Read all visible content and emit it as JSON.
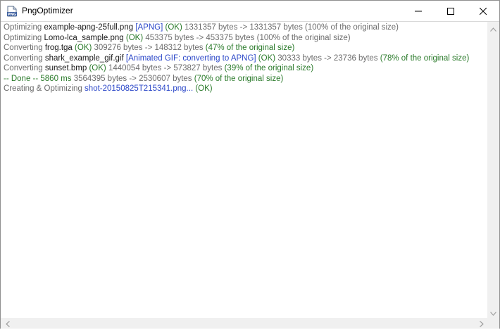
{
  "window": {
    "title": "PngOptimizer",
    "app_icon": "png-file-icon",
    "controls": {
      "minimize_icon": "minimize-icon",
      "maximize_icon": "maximize-icon",
      "close_icon": "close-icon"
    }
  },
  "log": {
    "lines": [
      [
        {
          "text": "Optimizing ",
          "cls": "c-verb"
        },
        {
          "text": "example-apng-25full.png",
          "cls": "c-file"
        },
        {
          "text": " [APNG]",
          "cls": "c-tag"
        },
        {
          "text": "  (OK)",
          "cls": "c-ok"
        },
        {
          "text": " 1331357 bytes -> 1331357 bytes (100% of the original size)",
          "cls": "c-bytes"
        }
      ],
      [
        {
          "text": "Optimizing ",
          "cls": "c-verb"
        },
        {
          "text": "Lomo-lca_sample.png",
          "cls": "c-file"
        },
        {
          "text": "  (OK)",
          "cls": "c-ok"
        },
        {
          "text": " 453375 bytes -> 453375 bytes (100% of the original size)",
          "cls": "c-bytes"
        }
      ],
      [
        {
          "text": "Converting ",
          "cls": "c-verb"
        },
        {
          "text": "frog.tga",
          "cls": "c-file"
        },
        {
          "text": "  (OK)",
          "cls": "c-ok"
        },
        {
          "text": " 309276 bytes -> 148312 bytes ",
          "cls": "c-bytes"
        },
        {
          "text": "(47% of the original size)",
          "cls": "c-pct-green"
        }
      ],
      [
        {
          "text": "Converting ",
          "cls": "c-verb"
        },
        {
          "text": "shark_example_gif.gif",
          "cls": "c-file"
        },
        {
          "text": " [Animated GIF: converting to APNG]",
          "cls": "c-tag"
        },
        {
          "text": "  (OK)",
          "cls": "c-ok"
        },
        {
          "text": " 30333 bytes -> 23736 bytes ",
          "cls": "c-bytes"
        },
        {
          "text": "(78% of the original size)",
          "cls": "c-pct-green"
        }
      ],
      [
        {
          "text": "Converting ",
          "cls": "c-verb"
        },
        {
          "text": "sunset.bmp",
          "cls": "c-file"
        },
        {
          "text": "  (OK)",
          "cls": "c-ok"
        },
        {
          "text": " 1440054 bytes -> 573827 bytes ",
          "cls": "c-bytes"
        },
        {
          "text": "(39% of the original size)",
          "cls": "c-pct-green"
        }
      ],
      [
        {
          "text": "-- Done --   5860 ms",
          "cls": "c-done"
        },
        {
          "text": " 3564395 bytes -> 2530607 bytes ",
          "cls": "c-bytes"
        },
        {
          "text": "(70% of the original size)",
          "cls": "c-pct-green"
        }
      ],
      [
        {
          "text": "Creating & Optimizing ",
          "cls": "c-verb"
        },
        {
          "text": "shot-20150825T215341.png...",
          "cls": "c-link"
        },
        {
          "text": "  (OK)",
          "cls": "c-ok"
        }
      ]
    ]
  },
  "scrollbars": {
    "up_icon": "scroll-up-arrow-icon",
    "down_icon": "scroll-down-arrow-icon",
    "left_icon": "scroll-left-arrow-icon",
    "right_icon": "scroll-right-arrow-icon"
  },
  "colors": {
    "gray_text": "#6d6d6d",
    "file_text": "#1a1a1a",
    "blue_tag": "#2b47c8",
    "green_ok": "#2a7a2a"
  }
}
